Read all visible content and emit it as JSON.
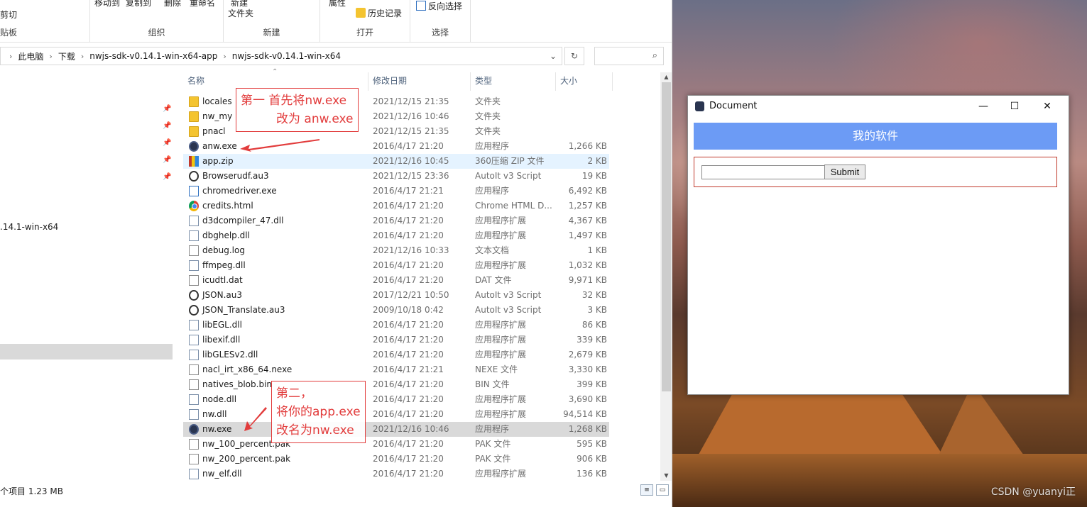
{
  "ribbon": {
    "clipboard": {
      "label": "贴板",
      "cut": "剪切",
      "move_to": "移动到",
      "copy_to": "复制到"
    },
    "organize": {
      "label": "组织",
      "delete": "删除",
      "rename": "重命名"
    },
    "new": {
      "label": "新建",
      "new_folder_line1": "新建",
      "new_folder_line2": "文件夹"
    },
    "open": {
      "label": "打开",
      "properties": "属性",
      "history": "历史记录"
    },
    "select": {
      "label": "选择",
      "invert": "反向选择"
    }
  },
  "address": {
    "crumbs": [
      "此电脑",
      "下载",
      "nwjs-sdk-v0.14.1-win-x64-app",
      "nwjs-sdk-v0.14.1-win-x64"
    ],
    "search_placeholder": ""
  },
  "navpane": {
    "partial_item": ".14.1-win-x64"
  },
  "columns": {
    "name": "名称",
    "date": "修改日期",
    "type": "类型",
    "size": "大小"
  },
  "files": [
    {
      "name": "locales",
      "date": "2021/12/15 21:35",
      "type": "文件夹",
      "size": "",
      "icon": "folder"
    },
    {
      "name": "nw_my",
      "date": "2021/12/16 10:46",
      "type": "文件夹",
      "size": "",
      "icon": "folder"
    },
    {
      "name": "pnacl",
      "date": "2021/12/15 21:35",
      "type": "文件夹",
      "size": "",
      "icon": "folder"
    },
    {
      "name": "anw.exe",
      "date": "2016/4/17 21:20",
      "type": "应用程序",
      "size": "1,266 KB",
      "icon": "exe"
    },
    {
      "name": "app.zip",
      "date": "2021/12/16 10:45",
      "type": "360压缩 ZIP 文件",
      "size": "2 KB",
      "icon": "zip"
    },
    {
      "name": "Browserudf.au3",
      "date": "2021/12/15 23:36",
      "type": "AutoIt v3 Script",
      "size": "19 KB",
      "icon": "au3"
    },
    {
      "name": "chromedriver.exe",
      "date": "2016/4/17 21:21",
      "type": "应用程序",
      "size": "6,492 KB",
      "icon": "driver"
    },
    {
      "name": "credits.html",
      "date": "2016/4/17 21:20",
      "type": "Chrome HTML D...",
      "size": "1,257 KB",
      "icon": "chrome"
    },
    {
      "name": "d3dcompiler_47.dll",
      "date": "2016/4/17 21:20",
      "type": "应用程序扩展",
      "size": "4,367 KB",
      "icon": "dll"
    },
    {
      "name": "dbghelp.dll",
      "date": "2016/4/17 21:20",
      "type": "应用程序扩展",
      "size": "1,497 KB",
      "icon": "dll"
    },
    {
      "name": "debug.log",
      "date": "2021/12/16 10:33",
      "type": "文本文档",
      "size": "1 KB",
      "icon": "doc"
    },
    {
      "name": "ffmpeg.dll",
      "date": "2016/4/17 21:20",
      "type": "应用程序扩展",
      "size": "1,032 KB",
      "icon": "dll"
    },
    {
      "name": "icudtl.dat",
      "date": "2016/4/17 21:20",
      "type": "DAT 文件",
      "size": "9,971 KB",
      "icon": "doc"
    },
    {
      "name": "JSON.au3",
      "date": "2017/12/21 10:50",
      "type": "AutoIt v3 Script",
      "size": "32 KB",
      "icon": "au3"
    },
    {
      "name": "JSON_Translate.au3",
      "date": "2009/10/18 0:42",
      "type": "AutoIt v3 Script",
      "size": "3 KB",
      "icon": "au3"
    },
    {
      "name": "libEGL.dll",
      "date": "2016/4/17 21:20",
      "type": "应用程序扩展",
      "size": "86 KB",
      "icon": "dll"
    },
    {
      "name": "libexif.dll",
      "date": "2016/4/17 21:20",
      "type": "应用程序扩展",
      "size": "339 KB",
      "icon": "dll"
    },
    {
      "name": "libGLESv2.dll",
      "date": "2016/4/17 21:20",
      "type": "应用程序扩展",
      "size": "2,679 KB",
      "icon": "dll"
    },
    {
      "name": "nacl_irt_x86_64.nexe",
      "date": "2016/4/17 21:21",
      "type": "NEXE 文件",
      "size": "3,330 KB",
      "icon": "doc"
    },
    {
      "name": "natives_blob.bin",
      "date": "2016/4/17 21:20",
      "type": "BIN 文件",
      "size": "399 KB",
      "icon": "doc"
    },
    {
      "name": "node.dll",
      "date": "2016/4/17 21:20",
      "type": "应用程序扩展",
      "size": "3,690 KB",
      "icon": "dll"
    },
    {
      "name": "nw.dll",
      "date": "2016/4/17 21:20",
      "type": "应用程序扩展",
      "size": "94,514 KB",
      "icon": "dll"
    },
    {
      "name": "nw.exe",
      "date": "2021/12/16 10:46",
      "type": "应用程序",
      "size": "1,268 KB",
      "icon": "exe"
    },
    {
      "name": "nw_100_percent.pak",
      "date": "2016/4/17 21:20",
      "type": "PAK 文件",
      "size": "595 KB",
      "icon": "doc"
    },
    {
      "name": "nw_200_percent.pak",
      "date": "2016/4/17 21:20",
      "type": "PAK 文件",
      "size": "906 KB",
      "icon": "doc"
    },
    {
      "name": "nw_elf.dll",
      "date": "2016/4/17 21:20",
      "type": "应用程序扩展",
      "size": "136 KB",
      "icon": "dll"
    }
  ],
  "status": {
    "text": "个项目  1.23 MB"
  },
  "annotations": {
    "first_line1": "第一  首先将nw.exe",
    "first_line2": "改为 anw.exe",
    "second_line1": "第二，",
    "second_line2": "将你的app.exe",
    "second_line3": "改名为nw.exe"
  },
  "app": {
    "title": "Document",
    "header": "我的软件",
    "input_value": "",
    "submit_label": "Submit"
  },
  "watermark": "CSDN @yuanyi正"
}
